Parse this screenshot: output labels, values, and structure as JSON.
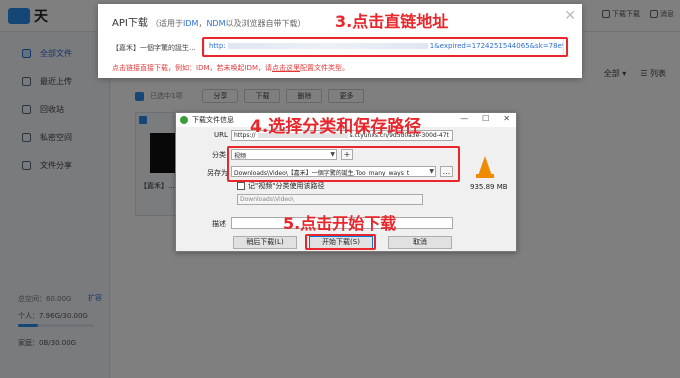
{
  "app": {
    "logo_text": "天",
    "top_links": [
      {
        "label": "下载下载",
        "icon": "download-icon"
      },
      {
        "label": "消息",
        "icon": "message-icon"
      }
    ]
  },
  "sidebar": {
    "items": [
      {
        "label": "全部文件",
        "icon": "folder-icon"
      },
      {
        "label": "最近上传",
        "icon": "upload-icon"
      },
      {
        "label": "回收站",
        "icon": "trash-icon"
      },
      {
        "label": "私密空间",
        "icon": "lock-icon"
      },
      {
        "label": "文件分享",
        "icon": "share-icon"
      }
    ],
    "quota_total": "总空间：60.00G",
    "quota_expand": "扩容",
    "quota_personal": "个人：7.96G/30.00G",
    "quota_personal_fraction": 0.265,
    "quota_family": "家庭：0B/30.00G"
  },
  "main": {
    "selected_text": "已选中1项",
    "toolbar_buttons": [
      "分享",
      "下载",
      "删除",
      "更多"
    ],
    "view_all": "全部 ▾",
    "view_list": "☰ 列表",
    "file_name": "【嘉禾】..."
  },
  "api_dialog": {
    "title": "API下载",
    "hint_prefix": "（适用于",
    "hint_idm": "IDM",
    "hint_sep": "，",
    "hint_ndm": "NDM",
    "hint_suffix": "以及浏览器自带下载）",
    "close": "✕",
    "file_label": "【嘉禾】一個字驚的誕生...",
    "link_prefix": "http:",
    "link_suffix": "1&expired=1724251544065&sk=78e92...",
    "note_prefix": "点击链接直接下载，例如：IDM，若未唤起IDM，请",
    "note_link": "点击这里",
    "note_suffix": "配置文件类型。"
  },
  "download_dialog": {
    "title": "下载文件信息",
    "url_label": "URL",
    "url_prefix": "https://",
    "url_suffix": "s.ctyunxs.cn/9d5d0a3e-300d-47t",
    "category_label": "分类",
    "category_value": "视频",
    "plus": "+",
    "saveas_label": "另存为",
    "saveas_value": "Downloads\\Video\\【嘉禾】一個字驚的誕生.Too_many_ways_t",
    "browse": "...",
    "remember_label": "记\"视频\"分类使用该路径",
    "default_path": "Downloads\\Video\\",
    "desc_label": "描述",
    "file_size": "935.89 MB",
    "btn_later": "稍后下载(L)",
    "btn_start": "开始下载(S)",
    "btn_cancel": "取消"
  },
  "annotations": {
    "step3": "3.点击直链地址",
    "step4": "4.选择分类和保存路径",
    "step5": "5.点击开始下载"
  },
  "colors": {
    "annotation_red": "#e8262b",
    "accent_blue": "#2b8cf0"
  }
}
